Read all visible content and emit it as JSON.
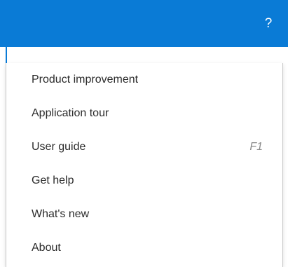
{
  "header": {
    "help_glyph": "?",
    "accent_color": "#0a7bd6"
  },
  "menu": {
    "items": [
      {
        "label": "Product improvement",
        "shortcut": ""
      },
      {
        "label": "Application tour",
        "shortcut": ""
      },
      {
        "label": "User guide",
        "shortcut": "F1"
      },
      {
        "label": "Get help",
        "shortcut": ""
      },
      {
        "label": "What's new",
        "shortcut": ""
      },
      {
        "label": "About",
        "shortcut": ""
      }
    ]
  }
}
